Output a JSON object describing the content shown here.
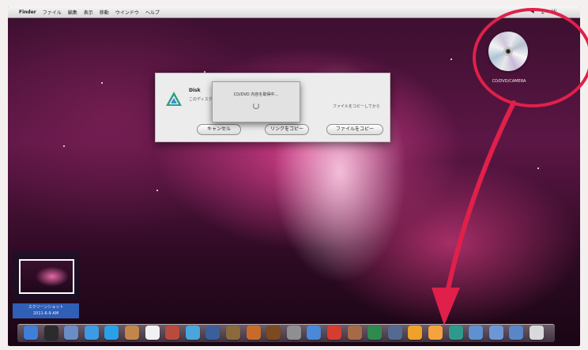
{
  "menubar": {
    "apple": "",
    "items": [
      "Finder",
      "ファイル",
      "編集",
      "表示",
      "移動",
      "ウインドウ",
      "ヘルプ"
    ],
    "status": [
      "◀︎",
      "⏚",
      "Hi"
    ]
  },
  "desktop": {
    "disc_label": "CD/DVD/CAMERA",
    "thumbnail_label": "スクリーンショット\n2011-6-9 AM"
  },
  "dialog": {
    "title": "Disk",
    "message": "このディスクにあるファイルを…",
    "right_message": "ファイルをコピーしてから",
    "buttons": {
      "cancel": "キャンセル",
      "copy_link": "リンクをコピー",
      "copy_file": "ファイルをコピー"
    },
    "progress": {
      "text": "CD/DVD 内容を取得中…"
    }
  },
  "dock": {
    "icons": [
      {
        "name": "finder-icon",
        "color": "#3f7fd6"
      },
      {
        "name": "dashboard-icon",
        "color": "#2b2b2b"
      },
      {
        "name": "mission-icon",
        "color": "#6b8cc4"
      },
      {
        "name": "safari-icon",
        "color": "#3c9be4"
      },
      {
        "name": "mail-icon",
        "color": "#2aa0e6"
      },
      {
        "name": "contacts-icon",
        "color": "#c2854a"
      },
      {
        "name": "ical-icon",
        "color": "#f1f1f1"
      },
      {
        "name": "preview-icon",
        "color": "#b84b3d"
      },
      {
        "name": "itunes-icon",
        "color": "#4aa5de"
      },
      {
        "name": "photo-icon",
        "color": "#3a5f9a"
      },
      {
        "name": "imovie-icon",
        "color": "#8a6a3c"
      },
      {
        "name": "garageband-icon",
        "color": "#c86b2a"
      },
      {
        "name": "guitar-icon",
        "color": "#7c4a1e"
      },
      {
        "name": "wrench-icon",
        "color": "#8f8f8f"
      },
      {
        "name": "appstore-icon",
        "color": "#4a88d8"
      },
      {
        "name": "system-icon",
        "color": "#d63c2f"
      },
      {
        "name": "tool-icon",
        "color": "#a66b46"
      },
      {
        "name": "chart-icon",
        "color": "#2f8a4f"
      },
      {
        "name": "print-icon",
        "color": "#556a92"
      },
      {
        "name": "triangle-icon",
        "color": "#f0a12a"
      },
      {
        "name": "vlc-icon",
        "color": "#f4a340"
      },
      {
        "name": "disk-utility-icon",
        "color": "#2f9a8c"
      },
      {
        "name": "folder-icon",
        "color": "#5f90cf"
      },
      {
        "name": "downloads-icon",
        "color": "#6d96d6"
      },
      {
        "name": "documents-icon",
        "color": "#5a86c8"
      },
      {
        "name": "trash-icon",
        "color": "#d9d9d9"
      }
    ]
  }
}
